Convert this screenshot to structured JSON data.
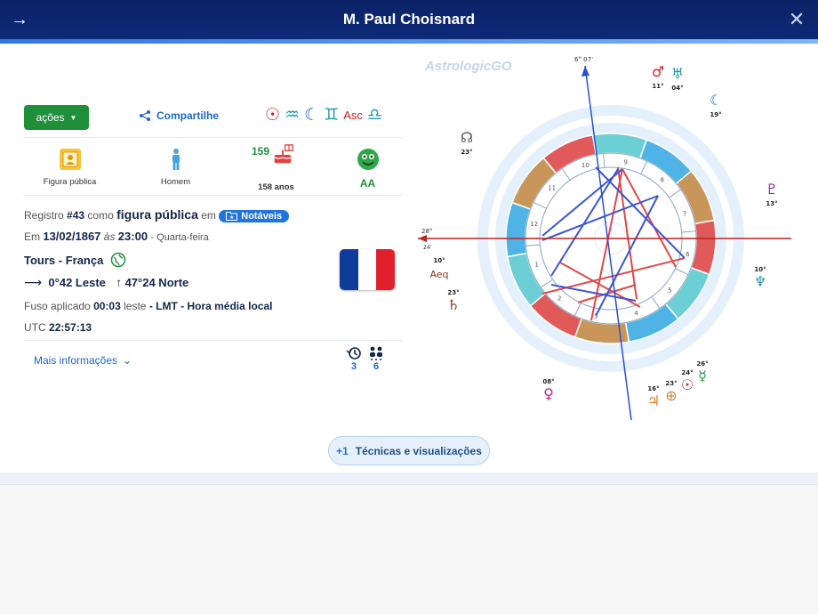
{
  "header": {
    "title": "M. Paul Choisnard",
    "back_icon": "arrow-right-icon",
    "close_icon": "close-icon"
  },
  "actions": {
    "acoes_label": "ações",
    "share_label": "Compartilhe",
    "sign_symbols": [
      "☉",
      "♒",
      "☾",
      "♊",
      "Asc",
      "♎"
    ]
  },
  "stats": {
    "figure": {
      "label": "Figura pública",
      "icon": "portrait-icon"
    },
    "gender": {
      "label": "Homem",
      "icon": "man-icon"
    },
    "age": {
      "years_label": "158 anos",
      "birthday_count": "159",
      "icon": "birthday-cake-icon"
    },
    "rating": {
      "label": "AA",
      "icon": "rating-face-icon"
    }
  },
  "info": {
    "registry_prefix": "Registro",
    "registry_number": "#43",
    "registry_as": "como",
    "registry_type": "figura pública",
    "registry_in": "em",
    "notaveis_label": "Notáveis",
    "date_prefix": "Em",
    "date": "13/02/1867",
    "at": "às",
    "time": "23:00",
    "weekday": "- Quarta-feira",
    "city": "Tours - França",
    "longitude": "0°42 Leste",
    "latitude": "47°24 Norte",
    "tz_prefix": "Fuso aplicado",
    "tz_offset": "00:03",
    "tz_dir": "leste",
    "tz_name": "- LMT - Hora média local",
    "utc_prefix": "UTC",
    "utc_time": "22:57:13",
    "more_label": "Mais informações",
    "mini_history_count": "3",
    "mini_people_count": "6"
  },
  "flag_colors": [
    "#0f3c9b",
    "#ffffff",
    "#e1202e"
  ],
  "tech_button": {
    "plus": "+1",
    "label": "Técnicas e visualizações"
  },
  "chart": {
    "logo": "AstrologicGO",
    "mc_label": "6° 07'",
    "asc_label_top": "28°",
    "asc_label_bottom": "24'",
    "house_numbers": [
      "10",
      "11",
      "12",
      "1",
      "2",
      "3",
      "4",
      "5",
      "6",
      "7",
      "8",
      "9"
    ],
    "planets": [
      {
        "glyph": "♂",
        "degree": "11°",
        "color": "#d42020"
      },
      {
        "glyph": "♅",
        "degree": "04°",
        "color": "#1f9aa8"
      },
      {
        "glyph": "☾",
        "degree": "19°",
        "color": "#1f66c9"
      },
      {
        "glyph": "☊",
        "degree": "23°",
        "color": "#555555"
      },
      {
        "glyph": "♇",
        "degree": "13°",
        "color": "#a0208f"
      },
      {
        "glyph": "♆",
        "degree": "10°",
        "color": "#1f9aa8"
      },
      {
        "glyph": "Aeq",
        "degree": "10°",
        "color": "#8a3a1a"
      },
      {
        "glyph": "♄",
        "degree": "23°",
        "color": "#8a3a1a"
      },
      {
        "glyph": "♀",
        "degree": "08°",
        "color": "#c020a0"
      },
      {
        "glyph": "♃",
        "degree": "16°",
        "color": "#e07a20"
      },
      {
        "glyph": "⊕",
        "degree": "23°",
        "color": "#c08a40"
      },
      {
        "glyph": "☉",
        "degree": "24°",
        "color": "#d42020"
      },
      {
        "glyph": "☿",
        "degree": "26°",
        "color": "#1f8f3a"
      }
    ]
  }
}
